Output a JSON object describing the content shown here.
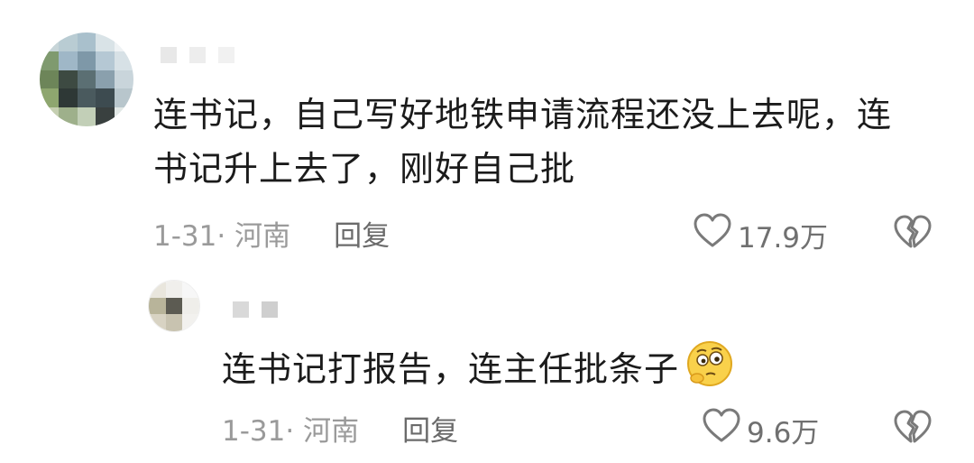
{
  "comment": {
    "text_line1": "连书记，自己写好地铁申请流程还没上去呢，连",
    "text_line2": "书记升上去了，刚好自己批",
    "date_location": "1-31· 河南",
    "reply_label": "回复",
    "likes": "17.9万"
  },
  "reply": {
    "text": "连书记打报告，连主任批条子",
    "emoji": "thinking-face-emoji",
    "date_location": "1-31· 河南",
    "reply_label": "回复",
    "likes": "9.6万"
  },
  "icons": {
    "like": "heart-outline-icon",
    "dislike": "broken-heart-icon"
  },
  "colors": {
    "text": "#1b1b1b",
    "meta": "#9a9a9a",
    "icon": "#7a7a7a"
  }
}
